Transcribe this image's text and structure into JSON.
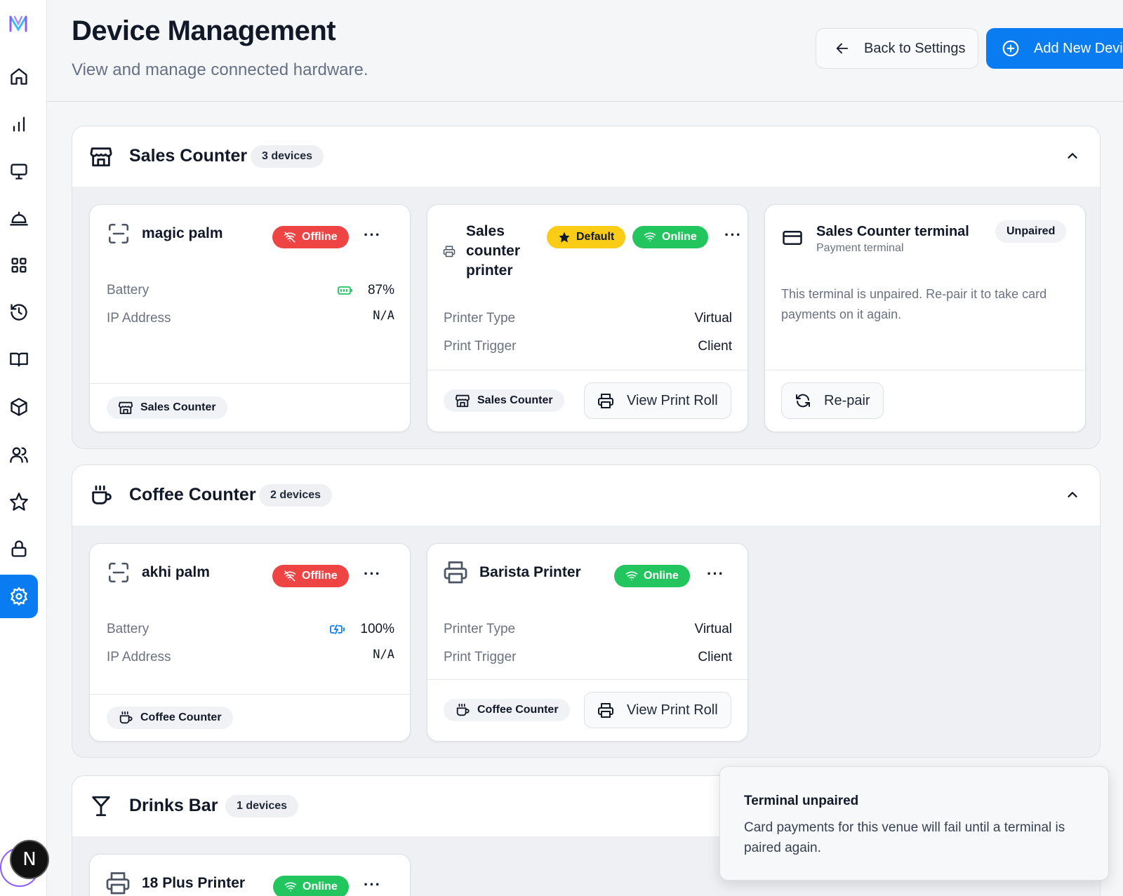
{
  "header": {
    "title": "Device Management",
    "subtitle": "View and manage connected hardware.",
    "back_label": "Back to Settings",
    "add_label": "Add New Device"
  },
  "sidebar": {
    "items": [
      "home",
      "analytics",
      "devices",
      "service",
      "apps",
      "history",
      "menu",
      "products",
      "customers",
      "favorites",
      "security",
      "settings"
    ],
    "active": "settings",
    "avatar_letter": "N"
  },
  "groups": [
    {
      "title": "Sales Counter",
      "count": "3 devices",
      "devices": [
        {
          "name": "magic palm",
          "status": "Offline",
          "rows": [
            {
              "label": "Battery",
              "value": "87%"
            },
            {
              "label": "IP Address",
              "value": "N/A"
            }
          ],
          "location": "Sales Counter"
        },
        {
          "name": "Sales counter printer",
          "name_lines": [
            "Sales",
            "counter",
            "printer"
          ],
          "default_label": "Default",
          "status": "Online",
          "rows": [
            {
              "label": "Printer Type",
              "value": "Virtual"
            },
            {
              "label": "Print Trigger",
              "value": "Client"
            }
          ],
          "location": "Sales Counter",
          "action": "View Print Roll"
        },
        {
          "name": "Sales Counter terminal",
          "subtitle": "Payment terminal",
          "status": "Unpaired",
          "message": "This terminal is unpaired. Re-pair it to take card payments on it again.",
          "action": "Re-pair"
        }
      ]
    },
    {
      "title": "Coffee Counter",
      "count": "2 devices",
      "devices": [
        {
          "name": "akhi palm",
          "status": "Offline",
          "rows": [
            {
              "label": "Battery",
              "value": "100%"
            },
            {
              "label": "IP Address",
              "value": "N/A"
            }
          ],
          "location": "Coffee Counter"
        },
        {
          "name": "Barista Printer",
          "status": "Online",
          "rows": [
            {
              "label": "Printer Type",
              "value": "Virtual"
            },
            {
              "label": "Print Trigger",
              "value": "Client"
            }
          ],
          "location": "Coffee Counter",
          "action": "View Print Roll"
        }
      ]
    },
    {
      "title": "Drinks Bar",
      "count": "1 devices",
      "devices": [
        {
          "name": "18 Plus Printer",
          "status": "Online"
        }
      ]
    }
  ],
  "toast": {
    "title": "Terminal unpaired",
    "body": "Card payments for this venue will fail until a terminal is paired again."
  },
  "colors": {
    "accent": "#0a7cf2",
    "offline": "#ef4444",
    "online": "#22c55e",
    "default": "#facc15"
  }
}
